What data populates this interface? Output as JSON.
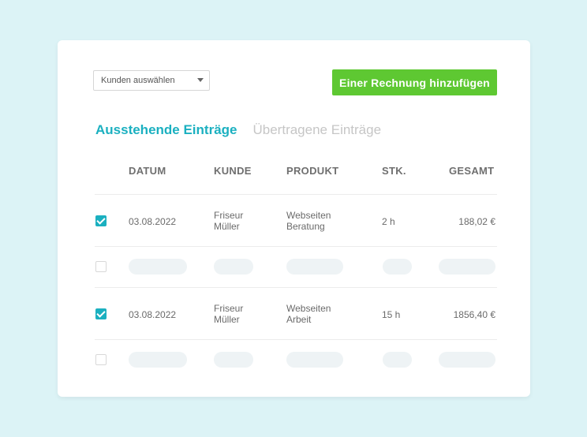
{
  "toolbar": {
    "customer_select_value": "Kunden auswählen",
    "add_button_label": "Einer Rechnung hinzufügen"
  },
  "tabs": [
    {
      "label": "Ausstehende Einträge",
      "active": true
    },
    {
      "label": "Übertragene Einträge",
      "active": false
    }
  ],
  "table": {
    "headers": {
      "date": "DATUM",
      "customer": "KUNDE",
      "product": "PRODUKT",
      "qty": "STK.",
      "total": "GESAMT"
    },
    "rows": [
      {
        "checked": true,
        "date": "03.08.2022",
        "customer_line1": "Friseur",
        "customer_line2": "Müller",
        "product_line1": "Webseiten",
        "product_line2": "Beratung",
        "qty": "2 h",
        "total": "188,02 €"
      },
      {
        "checked": true,
        "date": "03.08.2022",
        "customer_line1": "Friseur",
        "customer_line2": "Müller",
        "product_line1": "Webseiten",
        "product_line2": "Arbeit",
        "qty": "15 h",
        "total": "1856,40 €"
      }
    ]
  },
  "colors": {
    "accent": "#1bb0c0",
    "button": "#5ec832",
    "background": "#dcf3f6",
    "placeholder": "#eef3f5"
  },
  "icons": {
    "dropdown": "chevron-down-icon",
    "checked": "checkbox-checked-icon",
    "unchecked": "checkbox-unchecked-icon"
  }
}
